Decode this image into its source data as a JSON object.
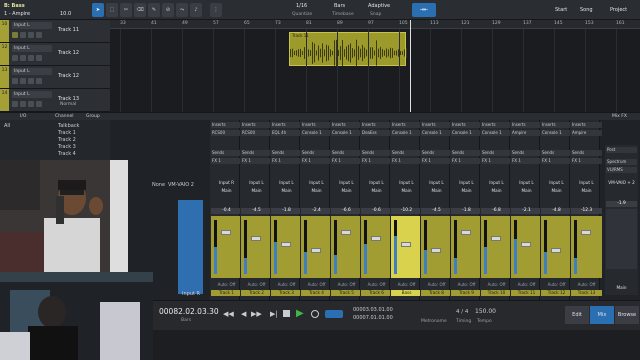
{
  "toolbar": {
    "track_label": "B: Bass",
    "track_sub": "1 - Ampire",
    "zoom": "10.0",
    "quantize_value": "1/16",
    "quantize_label": "Quantize",
    "timebase_value": "Bars",
    "timebase_label": "Timebase",
    "snap_value": "Adaptive",
    "snap_label": "Snap",
    "start_label": "Start",
    "song_label": "Song",
    "project_label": "Project"
  },
  "ruler": {
    "bars": [
      "33",
      "41",
      "49",
      "57",
      "65",
      "73",
      "81",
      "89",
      "97",
      "105",
      "113",
      "121",
      "129",
      "137",
      "145",
      "153",
      "161"
    ]
  },
  "tracks": [
    {
      "num": "10",
      "input": "Input L",
      "name": "Track 11"
    },
    {
      "num": "12",
      "input": "Input L",
      "name": "Track 12"
    },
    {
      "num": "13",
      "input": "Input L",
      "name": "Track 12"
    },
    {
      "num": "14",
      "input": "Input L",
      "name": "Track 13"
    }
  ],
  "tracklist_footer": {
    "mode": "Normal"
  },
  "event": {
    "label": "Track 11"
  },
  "browser_strip": {
    "channel_label": "Channel",
    "group_label": "Group",
    "io_label": "I/O",
    "all_label": "All",
    "mixfx_label": "Mix FX"
  },
  "channel_list": [
    "Talkback",
    "Track 1",
    "Track 2",
    "Track 3",
    "Track 4"
  ],
  "console": {
    "col_header_left": "None",
    "col_header_vm": "VM-VAIO 2",
    "inserts_label": "Inserts",
    "sends_label": "Sends",
    "fx_label": "FX 1",
    "input_bottom": "Input R",
    "mixfx_post": "Post",
    "spectrum": "Spectrum",
    "vu_label": "VU/RMS",
    "strips": [
      {
        "insert": "RCS00",
        "io": "Input R",
        "out": "Main",
        "vol": "-0.4",
        "name": "Track 1"
      },
      {
        "insert": "RCS00",
        "io": "Input L",
        "out": "Main",
        "vol": "-4.5",
        "name": "Track 2"
      },
      {
        "insert": "EQL 4h",
        "io": "Input L",
        "out": "Main",
        "vol": "-1.8",
        "name": "Track 3"
      },
      {
        "insert": "Console 1",
        "io": "Input L",
        "out": "Main",
        "vol": "-2.4",
        "name": "Track 4"
      },
      {
        "insert": "Console 1",
        "io": "Input L",
        "out": "Main",
        "vol": "-6.6",
        "name": "Track 5"
      },
      {
        "insert": "DeaEss",
        "io": "Input L",
        "out": "Main",
        "vol": "-0.6",
        "name": "Track 6"
      },
      {
        "insert": "Console 1",
        "io": "Input L",
        "out": "Main",
        "vol": "-10.2",
        "name": "Bass",
        "selected": true
      },
      {
        "insert": "Console 1",
        "io": "Input L",
        "out": "Main",
        "vol": "-4.5",
        "name": "Track 8"
      },
      {
        "insert": "Console 1",
        "io": "Input L",
        "out": "Main",
        "vol": "-1.8",
        "name": "Track 9"
      },
      {
        "insert": "Console 1",
        "io": "Input L",
        "out": "Main",
        "vol": "-6.8",
        "name": "Track 10"
      },
      {
        "insert": "Ampire",
        "io": "Input L",
        "out": "Main",
        "vol": "-2.1",
        "name": "Track 11"
      },
      {
        "insert": "Console 1",
        "io": "Input L",
        "out": "Main",
        "vol": "-4.8",
        "name": "Track 12"
      },
      {
        "insert": "Ampire",
        "io": "Input L",
        "out": "Main",
        "vol": "-12.3",
        "name": "Track 13"
      }
    ],
    "master": {
      "io": "VM-VAIO + 2",
      "vol": "-1.9",
      "name": "Main",
      "out": "Main"
    },
    "auto_label": "Auto: Off"
  },
  "transport": {
    "time": "00082.02.03.30",
    "time_label": "Bars",
    "loop_start": "00003.03.01.00",
    "loop_end": "00007.01.01.00",
    "metronome_label": "Metronome",
    "timesig": "4 / 4",
    "timing_label": "Timing",
    "tempo": "150.00",
    "tempo_label": "Tempo",
    "edit_label": "Edit",
    "mix_label": "Mix",
    "browse_label": "Browse"
  },
  "colors": {
    "track": "#a19d33",
    "selected": "#d9d24c",
    "accent": "#2b6fb3",
    "meter": "#3d7fc1"
  }
}
